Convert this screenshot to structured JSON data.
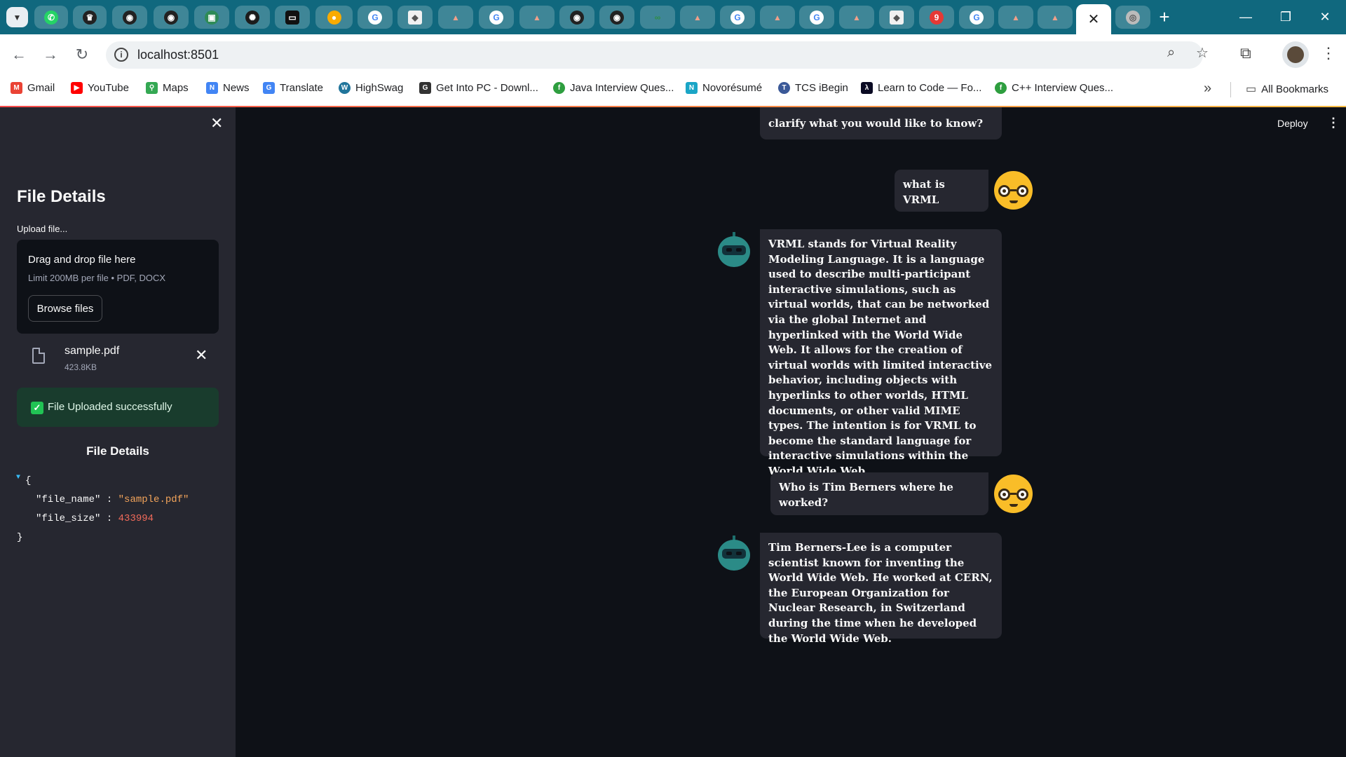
{
  "browser": {
    "url": "localhost:8501",
    "active_tab_close": "✕",
    "new_tab": "+",
    "window_controls": {
      "minimize": "—",
      "restore": "❐",
      "close": "✕"
    },
    "badge_count": "9",
    "bookmarks": [
      {
        "label": "Gmail",
        "icon": "gmail-icon",
        "color": "#ea4335"
      },
      {
        "label": "YouTube",
        "icon": "youtube-icon",
        "color": "#ff0000"
      },
      {
        "label": "Maps",
        "icon": "maps-icon",
        "color": "#34a853"
      },
      {
        "label": "News",
        "icon": "news-icon",
        "color": "#4285f4"
      },
      {
        "label": "Translate",
        "icon": "translate-icon",
        "color": "#4285f4"
      },
      {
        "label": "HighSwag",
        "icon": "wordpress-icon",
        "color": "#21759b"
      },
      {
        "label": "Get Into PC - Downl...",
        "icon": "getintopc-icon",
        "color": "#333333"
      },
      {
        "label": "Java Interview Ques...",
        "icon": "java-icon",
        "color": "#2e9e3f"
      },
      {
        "label": "Novorésumé",
        "icon": "novoresume-icon",
        "color": "#1aa5c6"
      },
      {
        "label": "TCS iBegin",
        "icon": "tcs-icon",
        "color": "#3b5998"
      },
      {
        "label": "Learn to Code — Fo...",
        "icon": "freecodecamp-icon",
        "color": "#0a0a23"
      },
      {
        "label": "C++ Interview Ques...",
        "icon": "cpp-icon",
        "color": "#2e9e3f"
      }
    ],
    "all_bookmarks": "All Bookmarks"
  },
  "sidebar": {
    "title": "File Details",
    "upload_label": "Upload file...",
    "dropzone_text": "Drag and drop file here",
    "dropzone_limit": "Limit 200MB per file • PDF, DOCX",
    "browse_button": "Browse files",
    "file": {
      "name": "sample.pdf",
      "size": "423.8KB"
    },
    "success_message": "File Uploaded successfully",
    "details_heading": "File Details",
    "json_view": {
      "open": "{",
      "close": "}",
      "file_name_key": "\"file_name\"",
      "file_name_value": "\"sample.pdf\"",
      "file_size_key": "\"file_size\"",
      "file_size_value": "433994",
      "separator": ":"
    }
  },
  "header": {
    "deploy": "Deploy",
    "menu": "⋮"
  },
  "chat": {
    "partial_top": "clarify what you would like to know?",
    "messages": [
      {
        "role": "user",
        "text": "what is VRML"
      },
      {
        "role": "assistant",
        "text": "VRML stands for Virtual Reality Modeling Language. It is a language used to describe multi-participant interactive simulations, such as virtual worlds, that can be networked via the global Internet and hyperlinked with the World Wide Web. It allows for the creation of  virtual worlds with limited interactive behavior, including objects with hyperlinks to other worlds, HTML documents, or other valid MIME types. The intention is for VRML to become the standard language for interactive simulations within the World Wide Web."
      },
      {
        "role": "user",
        "text": "Who is Tim Berners where he worked?"
      },
      {
        "role": "assistant",
        "text": "Tim Berners-Lee is a computer scientist known for inventing the World Wide Web. He worked at CERN, the European Organization for Nuclear Research, in Switzerland during the time when he developed the World Wide Web."
      }
    ]
  },
  "colors": {
    "tabstrip": "#10687e",
    "sidebar": "#262730",
    "main": "#0e1117",
    "success_bg": "#193c2d",
    "user_avatar": "#f9bd28",
    "bot_avatar": "#2b8b87"
  }
}
